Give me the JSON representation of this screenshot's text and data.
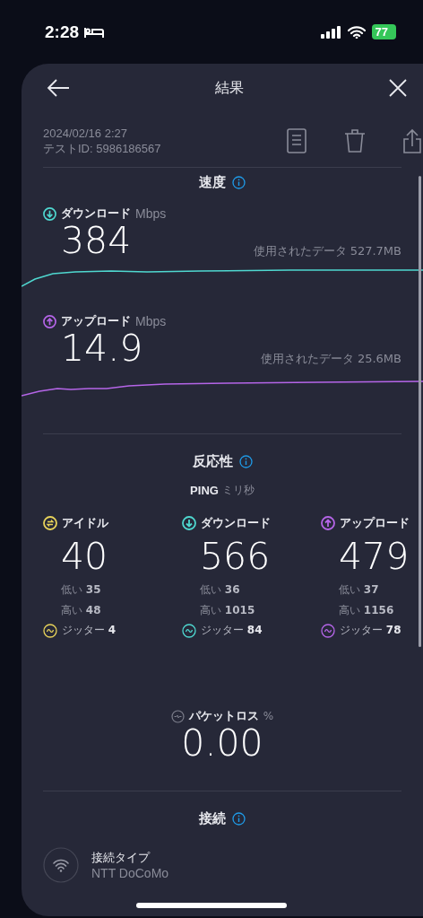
{
  "status_bar": {
    "time": "2:28",
    "battery": "77"
  },
  "header": {
    "title": "結果"
  },
  "meta": {
    "date": "2024/02/16 2:27",
    "test_id": "テストID: 5986186567"
  },
  "speed": {
    "title": "速度",
    "metrics": [
      {
        "kind": "download",
        "label": "ダウンロード",
        "unit": "Mbps",
        "value": "384",
        "data_used": "使用されたデータ 527.7MB",
        "color": "#4fd8d0"
      },
      {
        "kind": "upload",
        "label": "アップロード",
        "unit": "Mbps",
        "value": "14.9",
        "data_used": "使用されたデータ 25.6MB",
        "color": "#b565e8"
      }
    ]
  },
  "responsiveness": {
    "title": "反応性",
    "ping_label": "PING",
    "ping_unit": "ミリ秒",
    "columns": [
      {
        "kind": "idle",
        "label": "アイドル",
        "value": "40",
        "low": "低い **35**",
        "high": "高い **48**",
        "jitter": "ジッター **4**",
        "color": "#e8d35a"
      },
      {
        "kind": "download",
        "label": "ダウンロード",
        "value": "566",
        "low": "低い **36**",
        "high": "高い **1015**",
        "jitter": "ジッター **84**",
        "color": "#4fd8d0"
      },
      {
        "kind": "upload",
        "label": "アップロード",
        "value": "479",
        "low": "低い **37**",
        "high": "高い **1156**",
        "jitter": "ジッター **78**",
        "color": "#b565e8"
      }
    ]
  },
  "packet_loss": {
    "label": "パケットロス",
    "unit": "%",
    "value": "0.00"
  },
  "connection": {
    "title": "接続",
    "items": [
      {
        "kind": "wifi",
        "label": "接続タイプ",
        "value": "NTT DoCoMo"
      }
    ]
  }
}
